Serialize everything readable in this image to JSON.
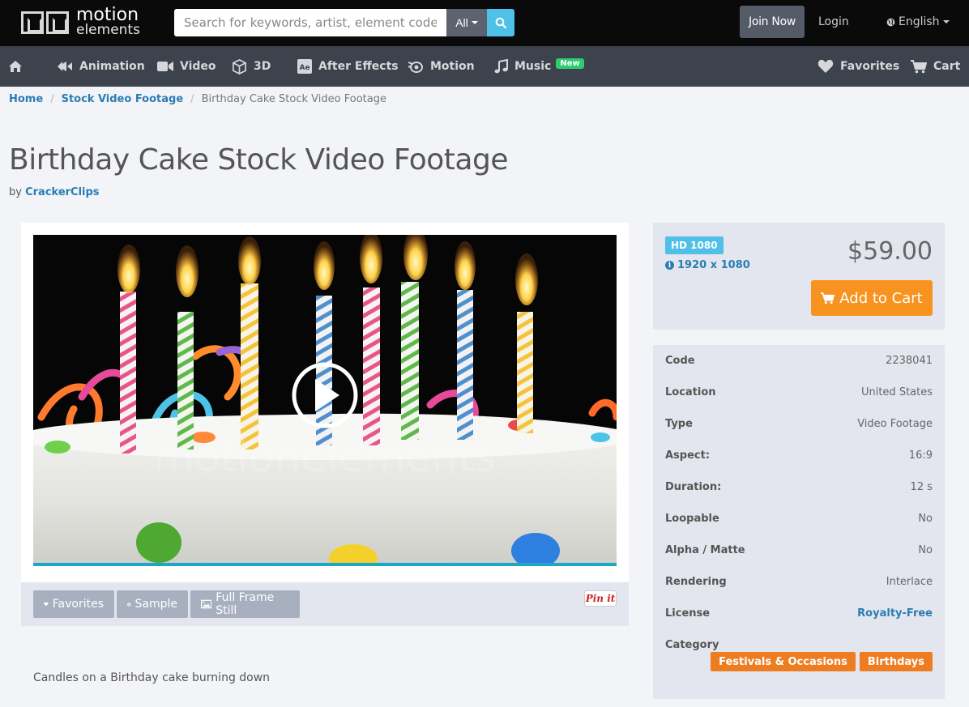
{
  "brand": {
    "line1": "motion",
    "line2": "elements"
  },
  "search": {
    "placeholder": "Search for keywords, artist, element code",
    "scope": "All"
  },
  "header": {
    "join_label": "Join Now",
    "login_label": "Login",
    "language": "English"
  },
  "nav": {
    "items": [
      {
        "label": "Animation",
        "icon": "animation-icon"
      },
      {
        "label": "Video",
        "icon": "video-camera-icon"
      },
      {
        "label": "3D",
        "icon": "cube-icon"
      },
      {
        "label": "After Effects",
        "icon": "after-effects-icon"
      },
      {
        "label": "Motion",
        "icon": "motion-icon"
      },
      {
        "label": "Music",
        "icon": "music-icon",
        "badge": "New"
      }
    ],
    "favorites_label": "Favorites",
    "cart_label": "Cart"
  },
  "breadcrumb": {
    "home": "Home",
    "section": "Stock Video Footage",
    "current": "Birthday Cake Stock Video Footage"
  },
  "page": {
    "title": "Birthday Cake Stock Video Footage",
    "by_prefix": "by",
    "author": "CrackerClips",
    "description": "Candles on a Birthday cake burning down"
  },
  "player": {
    "watermark": "motionelements",
    "progress": 1.0,
    "favorites_label": "Favorites",
    "sample_label": "Sample",
    "still_label": "Full Frame Still",
    "pin_label": "Pin it"
  },
  "purchase": {
    "quality_badge": "HD 1080",
    "resolution": "1920 x 1080",
    "price": "$59.00",
    "add_to_cart_label": "Add to Cart"
  },
  "details": [
    {
      "key": "Code",
      "value": "2238041"
    },
    {
      "key": "Location",
      "value": "United States"
    },
    {
      "key": "Type",
      "value": "Video Footage"
    },
    {
      "key": "Aspect:",
      "value": "16:9"
    },
    {
      "key": "Duration:",
      "value": "12 s"
    },
    {
      "key": "Loopable",
      "value": "No"
    },
    {
      "key": "Alpha / Matte",
      "value": "No"
    },
    {
      "key": "Rendering",
      "value": "Interlace"
    },
    {
      "key": "License",
      "value": "Royalty-Free"
    }
  ],
  "category": {
    "label": "Category",
    "tags": [
      "Festivals & Occasions",
      "Birthdays"
    ]
  },
  "colors": {
    "topbar": "#0a0a0a",
    "navbar": "#3d434d",
    "link": "#2a7db3",
    "accent_cyan": "#4fc1e9",
    "orange": "#f7931e",
    "tag_orange": "#ee7d22"
  }
}
